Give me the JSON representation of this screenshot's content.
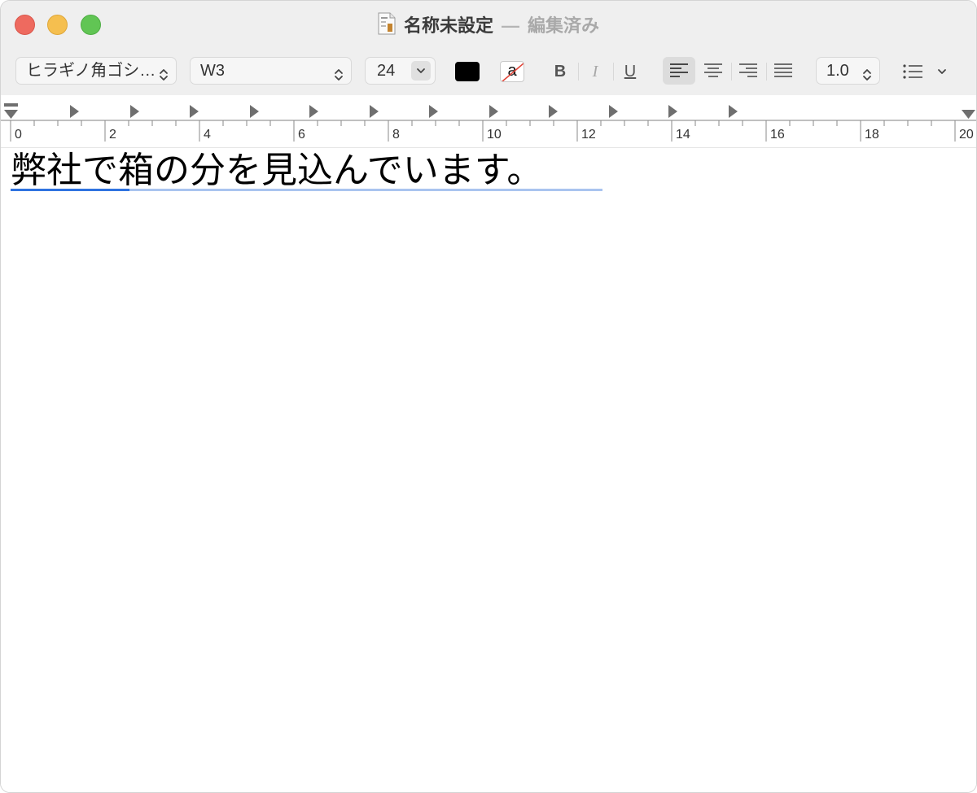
{
  "window": {
    "title": "名称未設定",
    "title_separator": "—",
    "status": "編集済み"
  },
  "toolbar": {
    "font_family": "ヒラギノ角ゴシ…",
    "font_weight": "W3",
    "font_size": "24",
    "text_color": "#000000",
    "background_color_glyph": "a",
    "bold_label": "B",
    "italic_label": "I",
    "underline_label": "U",
    "alignment_selected": "left",
    "line_spacing": "1.0"
  },
  "ruler": {
    "labels": [
      "0",
      "2",
      "4",
      "6",
      "8",
      "10",
      "12",
      "14",
      "16",
      "18",
      "20"
    ]
  },
  "document": {
    "text": "弊社で箱の分を見込んでいます。"
  },
  "colors": {
    "close": "#ee6a5f",
    "minimize": "#f5bf4f",
    "maximize": "#61c554",
    "marked_text_selected": "#2f73e0",
    "marked_text": "#a9c4ef"
  }
}
